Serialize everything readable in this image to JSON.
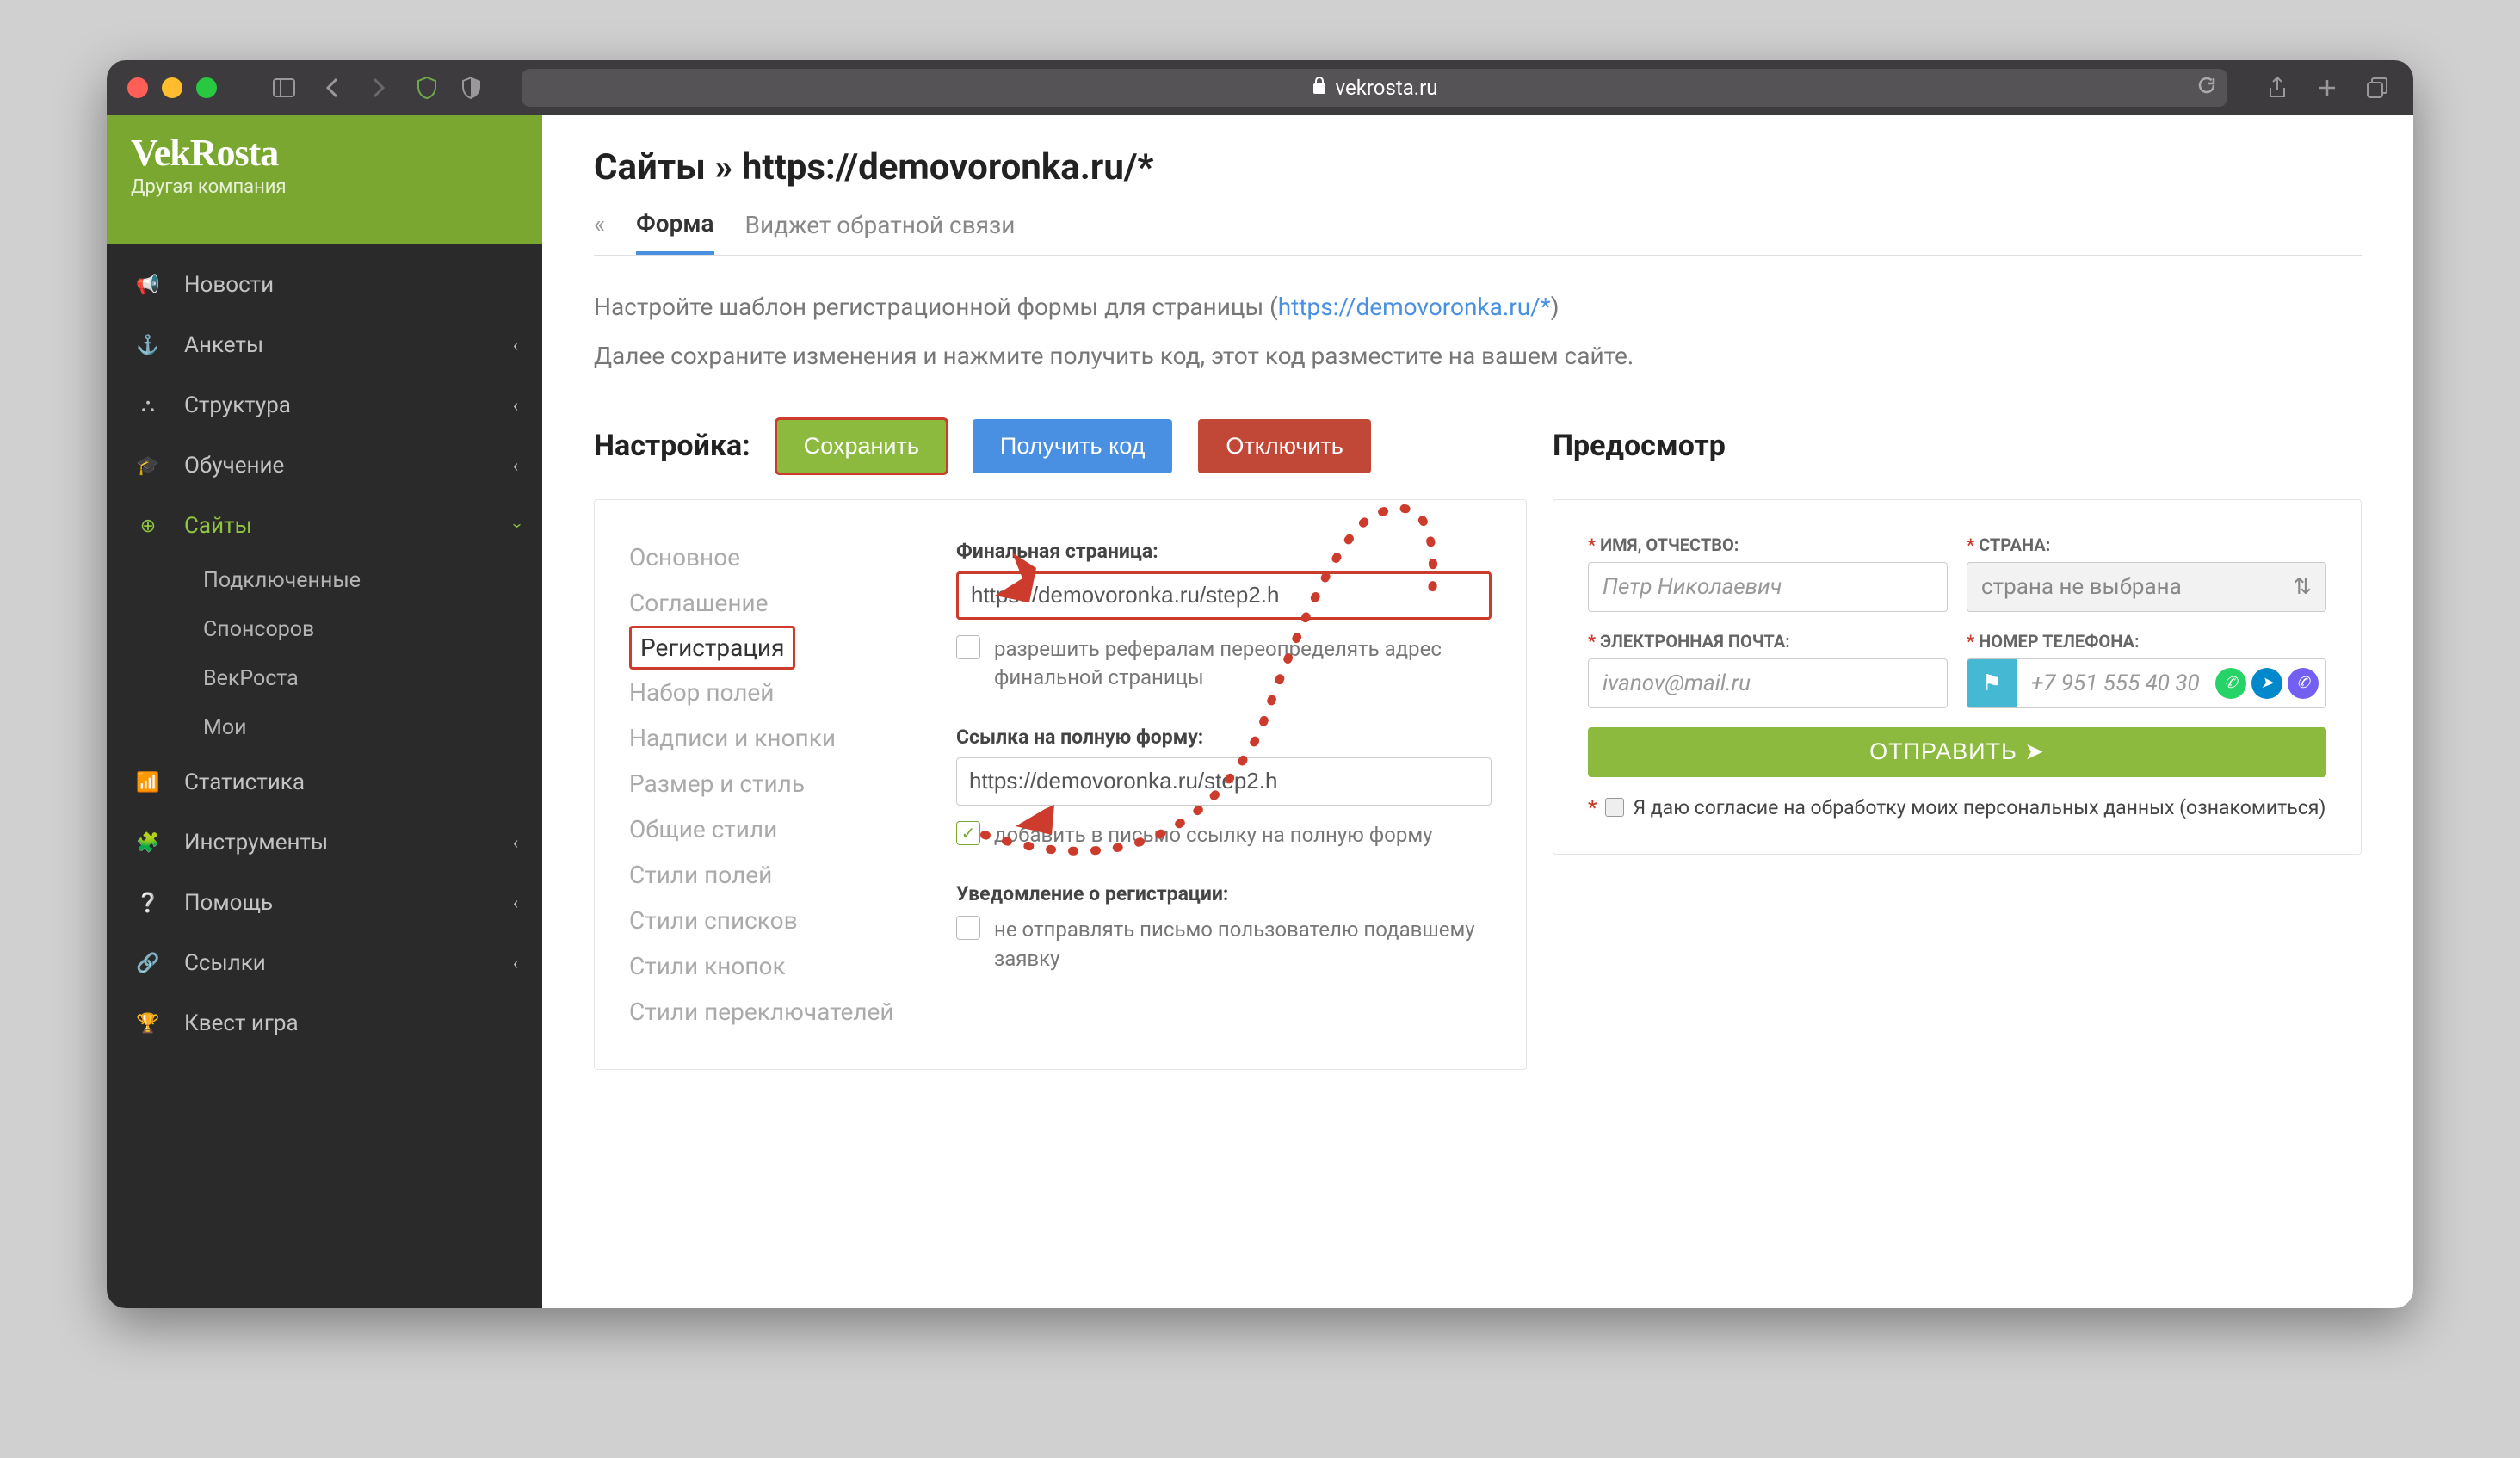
{
  "browser": {
    "url": "vekrosta.ru"
  },
  "sidebar": {
    "logo": "VekRosta",
    "company": "Другая компания",
    "items": [
      {
        "icon": "megaphone",
        "label": "Новости"
      },
      {
        "icon": "anchor",
        "label": "Анкеты",
        "expandable": true
      },
      {
        "icon": "sitemap",
        "label": "Структура",
        "expandable": true
      },
      {
        "icon": "gradcap",
        "label": "Обучение",
        "expandable": true
      },
      {
        "icon": "globe",
        "label": "Сайты",
        "expandable": true,
        "active": true,
        "expanded": true
      },
      {
        "icon": "chart",
        "label": "Статистика"
      },
      {
        "icon": "puzzle",
        "label": "Инструменты",
        "expandable": true
      },
      {
        "icon": "help",
        "label": "Помощь",
        "expandable": true
      },
      {
        "icon": "link",
        "label": "Ссылки",
        "expandable": true
      },
      {
        "icon": "trophy",
        "label": "Квест игра"
      }
    ],
    "sub_sites": [
      "Подключенные",
      "Спонсоров",
      "ВекРоста",
      "Мои"
    ]
  },
  "main": {
    "crumb_prefix": "Сайты » ",
    "crumb_url": "https://demovoronka.ru/*",
    "tabs": {
      "back": "«",
      "form": "Форма",
      "widget": "Виджет обратной связи"
    },
    "intro1a": "Настройте шаблон регистрационной формы для страницы (",
    "intro1_link": "https://demovoronka.ru/*",
    "intro1b": ")",
    "intro2": "Далее сохраните изменения и нажмите получить код, этот код разместите на вашем сайте.",
    "config_title": "Настройка:",
    "btn_save": "Сохранить",
    "btn_code": "Получить код",
    "btn_disable": "Отключить",
    "preview_title": "Предосмотр",
    "settings_menu": [
      "Основное",
      "Соглашение",
      "Регистрация",
      "Набор полей",
      "Надписи и кнопки",
      "Размер и стиль",
      "Общие стили",
      "Стили полей",
      "Стили списков",
      "Стили кнопок",
      "Стили переключателей"
    ],
    "settings_active_index": 2,
    "fields": {
      "final_page_label": "Финальная страница:",
      "final_page_value": "https://demovoronka.ru/step2.h",
      "allow_referrals": "разрешить рефералам переопределять адрес финальной страницы",
      "full_form_label": "Ссылка на полную форму:",
      "full_form_value": "https://demovoronka.ru/step2.h",
      "add_link_email": "добавить в письмо ссылку на полную форму",
      "notify_label": "Уведомление о регистрации:",
      "notify_skip": "не отправлять письмо пользователю подавшему заявку"
    },
    "preview": {
      "name_label": "ИМЯ, ОТЧЕСТВО:",
      "name_placeholder": "Петр Николаевич",
      "country_label": "СТРАНА:",
      "country_value": "страна не выбрана",
      "email_label": "ЭЛЕКТРОННАЯ ПОЧТА:",
      "email_placeholder": "ivanov@mail.ru",
      "phone_label": "НОМЕР ТЕЛЕФОНА:",
      "phone_placeholder": "+7 951 555 40 30",
      "submit": "ОТПРАВИТЬ ➤",
      "consent": "Я даю согласие на обработку моих персональных данных (ознакомиться)"
    }
  }
}
